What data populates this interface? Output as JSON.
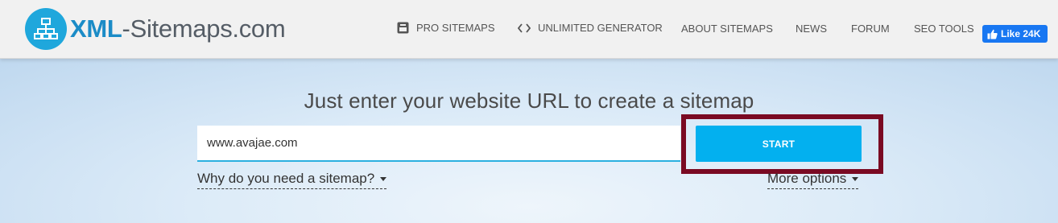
{
  "header": {
    "logo": {
      "brand_strong": "XML",
      "brand_rest": "-Sitemaps.com",
      "icon": "sitemap-icon"
    },
    "nav": [
      {
        "label": "PRO SITEMAPS",
        "icon": "box-icon"
      },
      {
        "label": "UNLIMITED GENERATOR",
        "icon": "code-icon"
      },
      {
        "label": "ABOUT SITEMAPS"
      },
      {
        "label": "NEWS"
      },
      {
        "label": "FORUM"
      },
      {
        "label": "SEO TOOLS"
      }
    ],
    "facebook_like": {
      "label": "Like 24K",
      "icon": "thumbs-up-icon"
    }
  },
  "hero": {
    "headline": "Just enter your website URL to create a sitemap",
    "url_input": {
      "value": "www.avajae.com",
      "placeholder": ""
    },
    "start_label": "START",
    "why_link": "Why do you need a sitemap?",
    "more_options_link": "More options"
  },
  "colors": {
    "accent": "#03b0ef",
    "brand_blue": "#1b8cc7",
    "highlight_border": "#7a0a23",
    "facebook_blue": "#1877f2"
  }
}
